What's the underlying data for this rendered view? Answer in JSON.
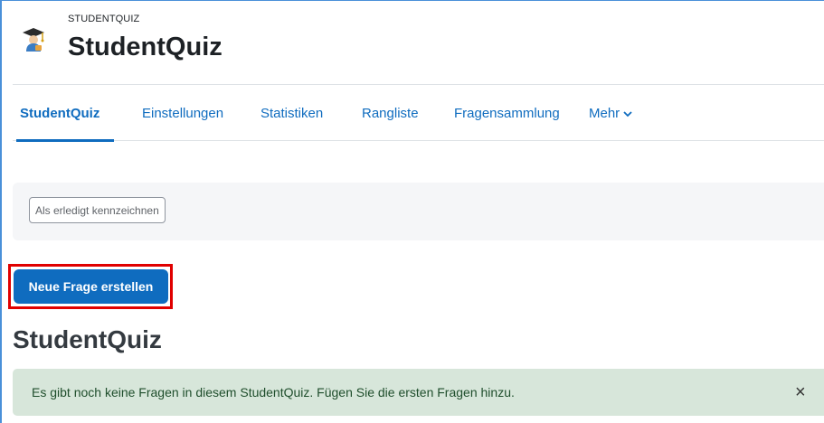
{
  "module": {
    "type_label": "STUDENTQUIZ",
    "title": "StudentQuiz",
    "icon": "graduation-cap-student-icon"
  },
  "nav": {
    "items": [
      {
        "label": "StudentQuiz",
        "active": true
      },
      {
        "label": "Einstellungen",
        "active": false
      },
      {
        "label": "Statistiken",
        "active": false
      },
      {
        "label": "Rangliste",
        "active": false
      },
      {
        "label": "Fragensammlung",
        "active": false
      },
      {
        "label": "Mehr",
        "active": false
      }
    ]
  },
  "completion": {
    "button_label": "Als erledigt kennzeichnen"
  },
  "actions": {
    "new_question_label": "Neue Frage erstellen"
  },
  "page": {
    "heading": "StudentQuiz"
  },
  "alert": {
    "message": "Es gibt noch keine Fragen in diesem StudentQuiz. Fügen Sie die ersten Fragen hinzu.",
    "close_glyph": "×"
  },
  "colors": {
    "primary": "#0f6cbf",
    "highlight": "#e00000",
    "alert_bg": "#d7e6da"
  }
}
